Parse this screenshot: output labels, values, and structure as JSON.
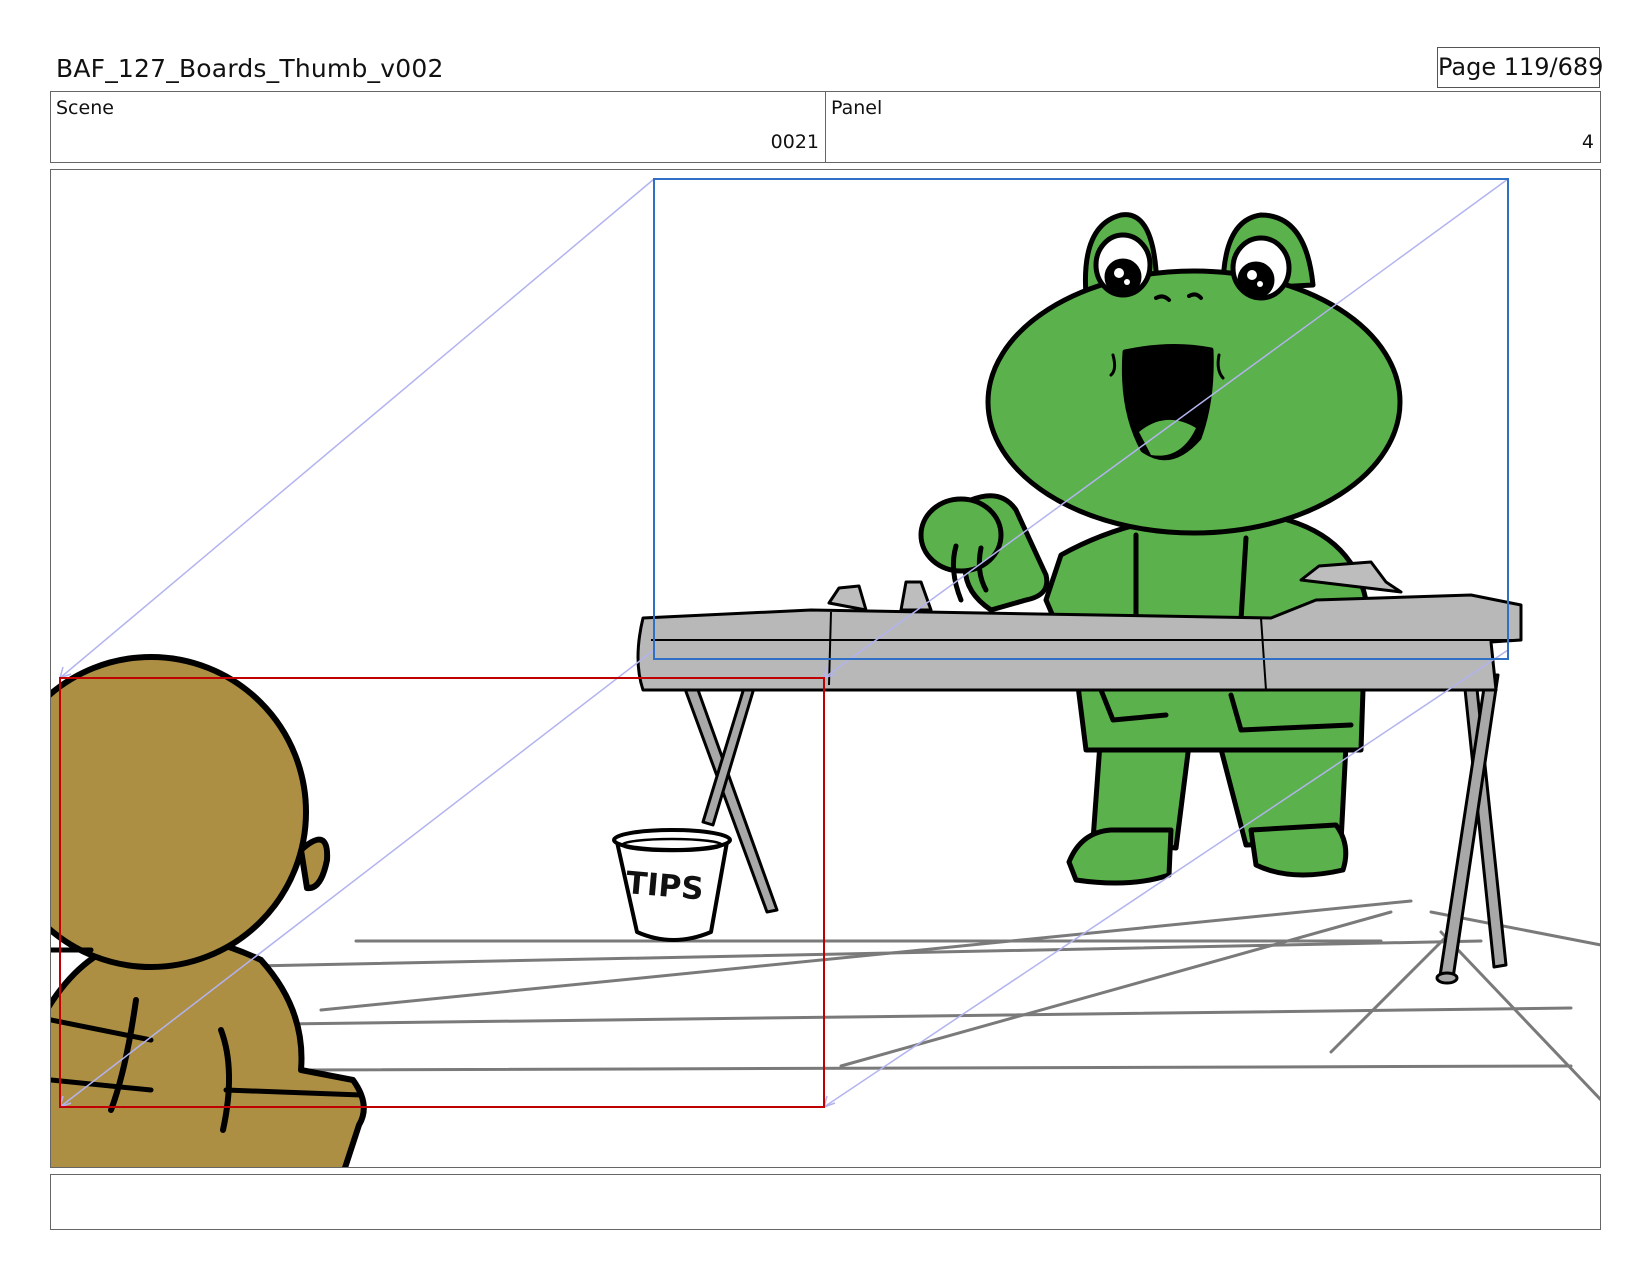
{
  "header": {
    "title": "BAF_127_Boards_Thumb_v002",
    "page_label": "Page 119/689"
  },
  "info": {
    "scene_label": "Scene",
    "scene_value": "0021",
    "panel_label": "Panel",
    "panel_value": "4"
  },
  "artwork": {
    "bucket_text": "TIPS",
    "colors": {
      "frog_green": "#5bb14b",
      "bear_brown": "#ad8f44",
      "table_gray": "#b3b3b3",
      "start_frame": "#c00000",
      "end_frame": "#2f6fc4",
      "camera_move_lines": "#b3b3f0"
    }
  },
  "notes": {
    "text": ""
  }
}
